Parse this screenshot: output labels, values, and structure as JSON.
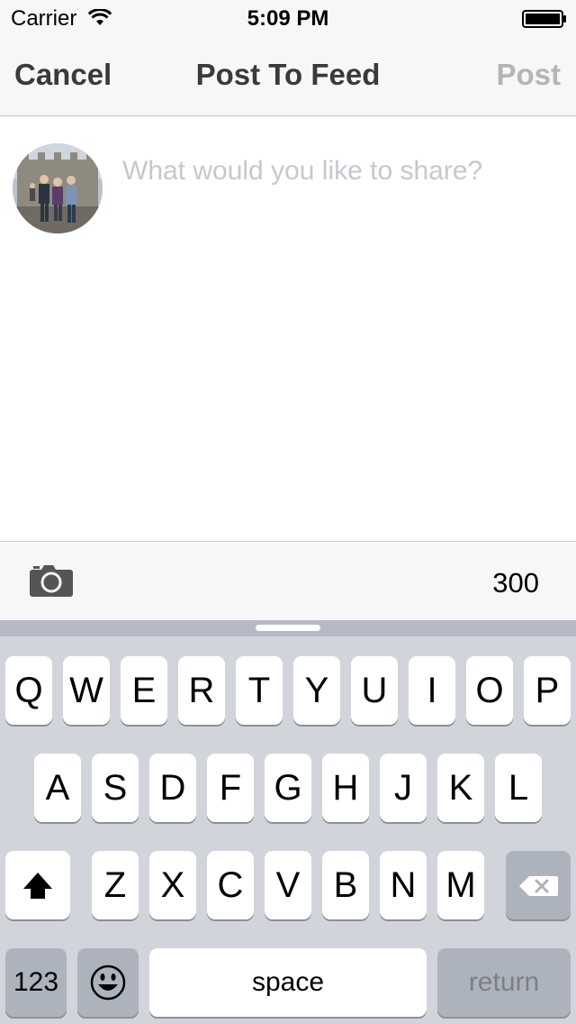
{
  "status_bar": {
    "carrier": "Carrier",
    "time": "5:09 PM"
  },
  "nav": {
    "cancel_label": "Cancel",
    "title": "Post To Feed",
    "post_label": "Post"
  },
  "compose": {
    "placeholder": "What would you like to share?",
    "value": ""
  },
  "toolbar": {
    "camera_icon": "camera-icon",
    "char_count": "300"
  },
  "keyboard": {
    "row1": [
      "Q",
      "W",
      "E",
      "R",
      "T",
      "Y",
      "U",
      "I",
      "O",
      "P"
    ],
    "row2": [
      "A",
      "S",
      "D",
      "F",
      "G",
      "H",
      "J",
      "K",
      "L"
    ],
    "row3": [
      "Z",
      "X",
      "C",
      "V",
      "B",
      "N",
      "M"
    ],
    "numbers_label": "123",
    "space_label": "space",
    "return_label": "return",
    "shift_icon": "shift-icon",
    "backspace_icon": "backspace-icon",
    "emoji_icon": "emoji-icon"
  },
  "colors": {
    "nav_text": "#3a3a3a",
    "post_disabled": "#b5b5b5",
    "placeholder": "#c7c7cd",
    "keyboard_bg": "#d1d5db",
    "dark_key": "#adb3bc"
  }
}
